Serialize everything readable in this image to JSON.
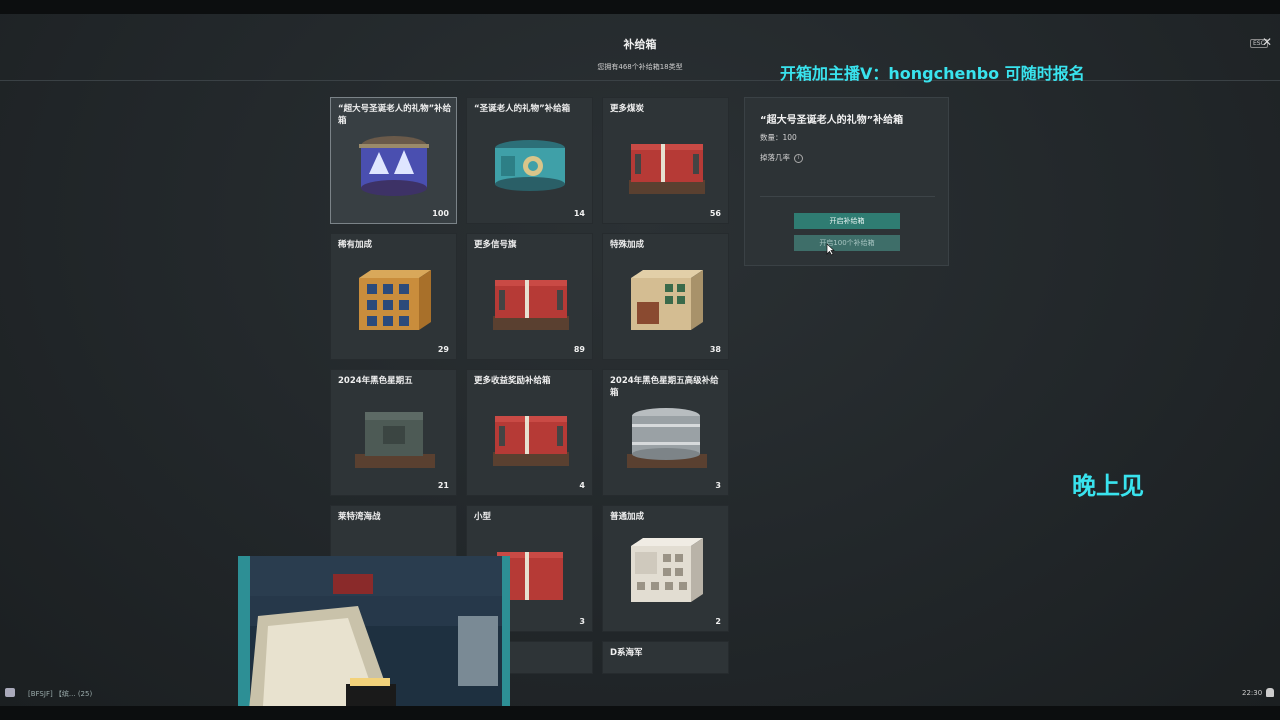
{
  "header": {
    "title": "补给箱",
    "subtitle": "您拥有468个补给箱18类型",
    "esc_label": "ESC",
    "close_symbol": "✕"
  },
  "overlays": {
    "promo": "开箱加主播V：hongchenbo 可随时报名",
    "night": "晚上见"
  },
  "cards": [
    {
      "name": "“超大号圣诞老人的礼物”补给箱",
      "count": "100",
      "art": "drum-blue",
      "selected": true
    },
    {
      "name": "“圣诞老人的礼物”补给箱",
      "count": "14",
      "art": "drum-teal"
    },
    {
      "name": "更多煤炭",
      "count": "56",
      "art": "crate-red"
    },
    {
      "name": "稀有加成",
      "count": "29",
      "art": "cabinet-orange"
    },
    {
      "name": "更多信号旗",
      "count": "89",
      "art": "crate-red"
    },
    {
      "name": "特殊加成",
      "count": "38",
      "art": "cabinet-beige"
    },
    {
      "name": "2024年黑色星期五",
      "count": "21",
      "art": "box-dark"
    },
    {
      "name": "更多收益奖励补给箱",
      "count": "4",
      "art": "crate-red"
    },
    {
      "name": "2024年黑色星期五高级补给箱",
      "count": "3",
      "art": "drum-silver"
    },
    {
      "name": "莱特湾海战",
      "count": "",
      "art": "none"
    },
    {
      "name": "小型",
      "count": "3",
      "art": "crate-red-small"
    },
    {
      "name": "普通加成",
      "count": "2",
      "art": "cabinet-white"
    },
    {
      "name": "",
      "count": "",
      "art": "none"
    },
    {
      "name": "",
      "count": "",
      "art": "none"
    },
    {
      "name": "D系海军",
      "count": "",
      "art": "none"
    }
  ],
  "panel": {
    "title": "“超大号圣诞老人的礼物”补给箱",
    "quantity": "数量：100",
    "drop_rate": "掉落几率",
    "info_symbol": "i",
    "open_button": "开启补给箱",
    "open100_button": "开启100个补给箱"
  },
  "bottom": {
    "clan": "[BFSJF] 【缤...    (25)",
    "time": "22:30"
  },
  "colors": {
    "accent_teal": "#2f7c72",
    "overlay_cyan": "#39e3ee"
  }
}
